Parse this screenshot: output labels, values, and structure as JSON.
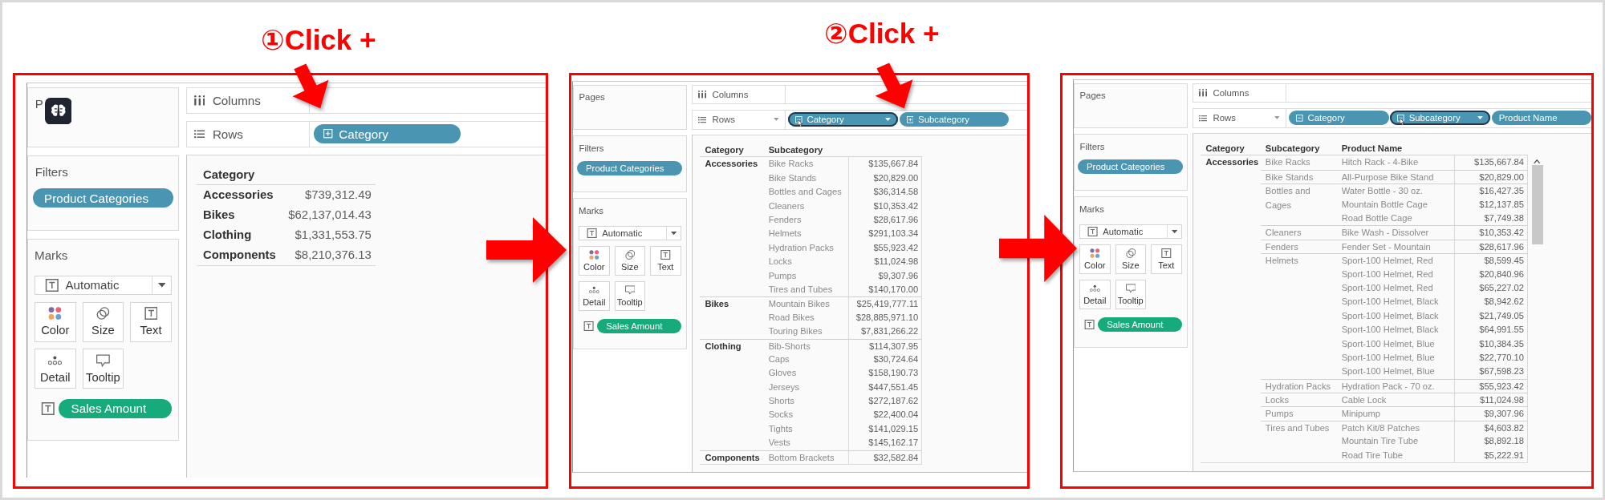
{
  "panels": [
    {
      "step": "①Click +",
      "pages_label": "P",
      "app_badge": true,
      "filters_label": "Filters",
      "filter_pills": [
        "Product Categories"
      ],
      "marks_label": "Marks",
      "mark_type": "Automatic",
      "mark_buttons": [
        {
          "kind": "color",
          "label": "Color"
        },
        {
          "kind": "size",
          "label": "Size"
        },
        {
          "kind": "text",
          "label": "Text"
        },
        {
          "kind": "detail",
          "label": "Detail"
        },
        {
          "kind": "tooltip",
          "label": "Tooltip"
        }
      ],
      "mark_pills": [
        {
          "kind": "text",
          "label": "Sales Amount"
        }
      ],
      "columns_label": "Columns",
      "rows_label": "Rows",
      "rows_dropdown": false,
      "rows_pills": [
        {
          "label": "Category",
          "expanded": false,
          "hovered": false
        }
      ],
      "scrollbar": false,
      "table": {
        "headers": [
          "Category"
        ],
        "groups": [
          {
            "label": "Accessories",
            "value": "$739,312.49"
          },
          {
            "label": "Bikes",
            "value": "$62,137,014.43"
          },
          {
            "label": "Clothing",
            "value": "$1,331,553.75"
          },
          {
            "label": "Components",
            "value": "$8,210,376.13"
          }
        ]
      }
    },
    {
      "step": "②Click +",
      "pages_label": "Pages",
      "app_badge": false,
      "filters_label": "Filters",
      "filter_pills": [
        "Product Categories"
      ],
      "marks_label": "Marks",
      "mark_type": "Automatic",
      "mark_buttons": [
        {
          "kind": "color",
          "label": "Color"
        },
        {
          "kind": "size",
          "label": "Size"
        },
        {
          "kind": "text",
          "label": "Text"
        },
        {
          "kind": "detail",
          "label": "Detail"
        },
        {
          "kind": "tooltip",
          "label": "Tooltip"
        }
      ],
      "mark_pills": [
        {
          "kind": "text",
          "label": "Sales Amount"
        }
      ],
      "columns_label": "Columns",
      "rows_label": "Rows",
      "rows_dropdown": true,
      "rows_pills": [
        {
          "label": "Category",
          "expanded": true,
          "hovered": true
        },
        {
          "label": "Subcategory",
          "expanded": false,
          "hovered": false
        }
      ],
      "scrollbar": false,
      "table": {
        "headers": [
          "Category",
          "Subcategory"
        ],
        "groups": [
          {
            "label": "Accessories",
            "children": [
              {
                "label": "Bike Racks",
                "value": "$135,667.84"
              },
              {
                "label": "Bike Stands",
                "value": "$20,829.00"
              },
              {
                "label": "Bottles and Cages",
                "value": "$36,314.58"
              },
              {
                "label": "Cleaners",
                "value": "$10,353.42"
              },
              {
                "label": "Fenders",
                "value": "$28,617.96"
              },
              {
                "label": "Helmets",
                "value": "$291,103.34"
              },
              {
                "label": "Hydration Packs",
                "value": "$55,923.42"
              },
              {
                "label": "Locks",
                "value": "$11,024.98"
              },
              {
                "label": "Pumps",
                "value": "$9,307.96"
              },
              {
                "label": "Tires and Tubes",
                "value": "$140,170.00"
              }
            ]
          },
          {
            "label": "Bikes",
            "children": [
              {
                "label": "Mountain Bikes",
                "value": "$25,419,777.11"
              },
              {
                "label": "Road Bikes",
                "value": "$28,885,971.10"
              },
              {
                "label": "Touring Bikes",
                "value": "$7,831,266.22"
              }
            ]
          },
          {
            "label": "Clothing",
            "children": [
              {
                "label": "Bib-Shorts",
                "value": "$114,307.95"
              },
              {
                "label": "Caps",
                "value": "$30,724.64"
              },
              {
                "label": "Gloves",
                "value": "$158,190.73"
              },
              {
                "label": "Jerseys",
                "value": "$447,551.45"
              },
              {
                "label": "Shorts",
                "value": "$272,187.62"
              },
              {
                "label": "Socks",
                "value": "$22,400.04"
              },
              {
                "label": "Tights",
                "value": "$141,029.15"
              },
              {
                "label": "Vests",
                "value": "$145,162.17"
              }
            ]
          },
          {
            "label": "Components",
            "children": [
              {
                "label": "Bottom Brackets",
                "value": "$32,582.84"
              }
            ]
          }
        ]
      }
    },
    {
      "pages_label": "Pages",
      "app_badge": false,
      "filters_label": "Filters",
      "filter_pills": [
        "Product Categories"
      ],
      "marks_label": "Marks",
      "mark_type": "Automatic",
      "mark_buttons": [
        {
          "kind": "color",
          "label": "Color"
        },
        {
          "kind": "size",
          "label": "Size"
        },
        {
          "kind": "text",
          "label": "Text"
        },
        {
          "kind": "detail",
          "label": "Detail"
        },
        {
          "kind": "tooltip",
          "label": "Tooltip"
        }
      ],
      "mark_pills": [
        {
          "kind": "text",
          "label": "Sales Amount"
        }
      ],
      "columns_label": "Columns",
      "rows_label": "Rows",
      "rows_dropdown": true,
      "rows_pills": [
        {
          "label": "Category",
          "expanded": true,
          "hovered": false
        },
        {
          "label": "Subcategory",
          "expanded": true,
          "hovered": true
        },
        {
          "label": "Product Name",
          "hovered": false
        }
      ],
      "scrollbar": true,
      "table": {
        "headers": [
          "Category",
          "Subcategory",
          "Product Name"
        ],
        "groups": [
          {
            "label": "Accessories",
            "children": [
              {
                "label": "Bike Racks",
                "children": [
                  {
                    "label": "Hitch Rack - 4-Bike",
                    "value": "$135,667.84"
                  }
                ]
              },
              {
                "label": "Bike Stands",
                "children": [
                  {
                    "label": "All-Purpose Bike Stand",
                    "value": "$20,829.00"
                  }
                ]
              },
              {
                "label": "Bottles and Cages",
                "children": [
                  {
                    "label": "Water Bottle - 30 oz.",
                    "value": "$16,427.35"
                  },
                  {
                    "label": "Mountain Bottle Cage",
                    "value": "$12,137.85"
                  },
                  {
                    "label": "Road Bottle Cage",
                    "value": "$7,749.38"
                  }
                ]
              },
              {
                "label": "Cleaners",
                "children": [
                  {
                    "label": "Bike Wash - Dissolver",
                    "value": "$10,353.42"
                  }
                ]
              },
              {
                "label": "Fenders",
                "children": [
                  {
                    "label": "Fender Set - Mountain",
                    "value": "$28,617.96"
                  }
                ]
              },
              {
                "label": "Helmets",
                "children": [
                  {
                    "label": "Sport-100 Helmet, Red",
                    "value": "$8,599.45"
                  },
                  {
                    "label": "Sport-100 Helmet, Red",
                    "value": "$20,840.96"
                  },
                  {
                    "label": "Sport-100 Helmet, Red",
                    "value": "$65,227.02"
                  },
                  {
                    "label": "Sport-100 Helmet, Black",
                    "value": "$8,942.62"
                  },
                  {
                    "label": "Sport-100 Helmet, Black",
                    "value": "$21,749.05"
                  },
                  {
                    "label": "Sport-100 Helmet, Black",
                    "value": "$64,991.55"
                  },
                  {
                    "label": "Sport-100 Helmet, Blue",
                    "value": "$10,384.35"
                  },
                  {
                    "label": "Sport-100 Helmet, Blue",
                    "value": "$22,770.10"
                  },
                  {
                    "label": "Sport-100 Helmet, Blue",
                    "value": "$67,598.23"
                  }
                ]
              },
              {
                "label": "Hydration Packs",
                "children": [
                  {
                    "label": "Hydration Pack - 70 oz.",
                    "value": "$55,923.42"
                  }
                ]
              },
              {
                "label": "Locks",
                "children": [
                  {
                    "label": "Cable Lock",
                    "value": "$11,024.98"
                  }
                ]
              },
              {
                "label": "Pumps",
                "children": [
                  {
                    "label": "Minipump",
                    "value": "$9,307.96"
                  }
                ]
              },
              {
                "label": "Tires and Tubes",
                "children": [
                  {
                    "label": "Patch Kit/8 Patches",
                    "value": "$4,603.82"
                  },
                  {
                    "label": "Mountain Tire Tube",
                    "value": "$8,892.18"
                  },
                  {
                    "label": "Road Tire Tube",
                    "value": "$5,222.91"
                  }
                ]
              }
            ]
          }
        ]
      }
    }
  ]
}
